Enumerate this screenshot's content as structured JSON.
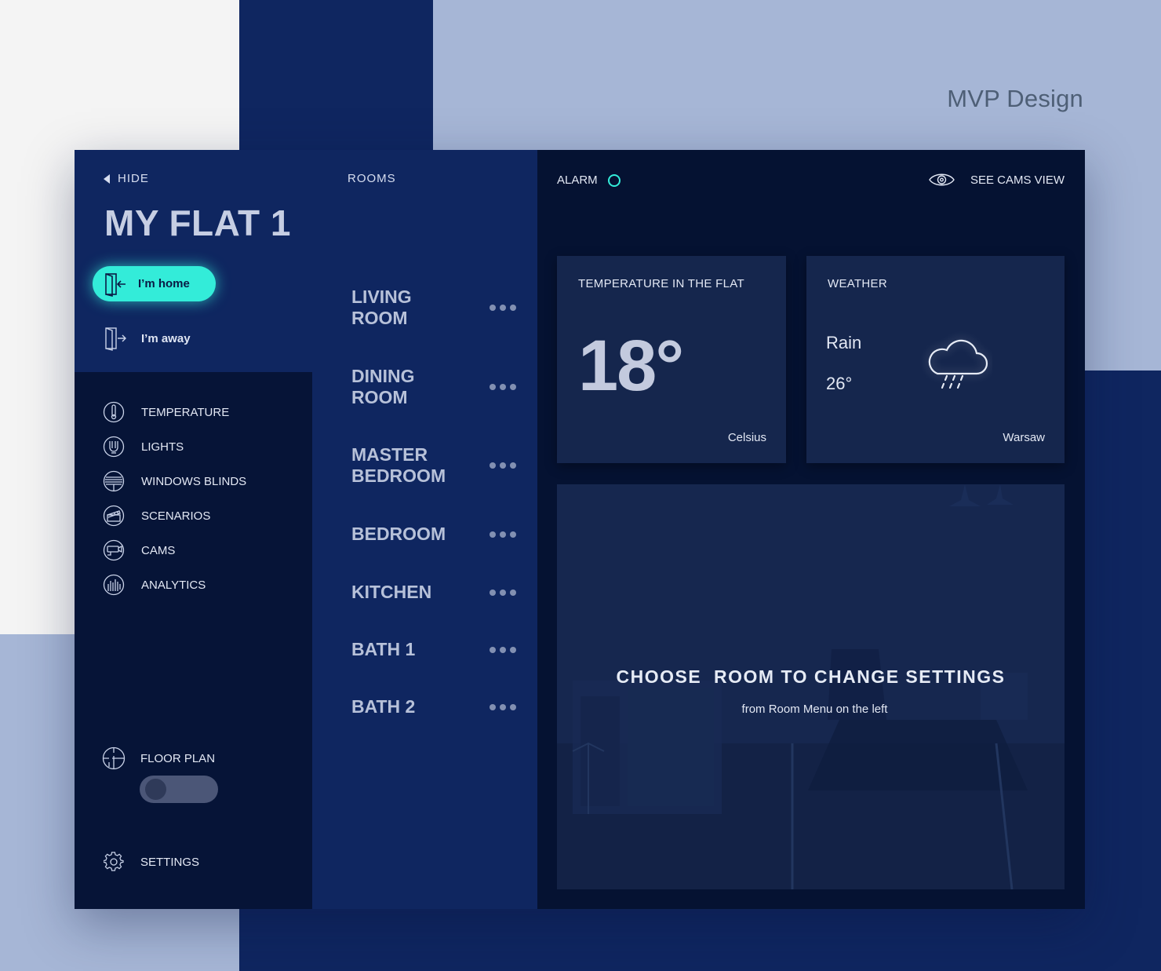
{
  "brand": {
    "title": "MVP Design"
  },
  "sidebar": {
    "hide_label": "HIDE",
    "flat_name": "MY FLAT 1",
    "modes": {
      "home": "I’m home",
      "away": "I’m away"
    },
    "menu": [
      {
        "label": "TEMPERATURE",
        "icon": "thermometer-icon"
      },
      {
        "label": "LIGHTS",
        "icon": "bulb-icon"
      },
      {
        "label": "WINDOWS BLINDS",
        "icon": "blinds-icon"
      },
      {
        "label": "SCENARIOS",
        "icon": "clapperboard-icon"
      },
      {
        "label": "CAMS",
        "icon": "camera-icon"
      },
      {
        "label": "ANALYTICS",
        "icon": "analytics-icon"
      }
    ],
    "floor_plan_label": "FLOOR PLAN",
    "floor_plan_enabled": false,
    "settings_label": "SETTINGS"
  },
  "rooms": {
    "header": "ROOMS",
    "items": [
      "LIVING ROOM",
      "DINING ROOM",
      "MASTER BEDROOM",
      "BEDROOM",
      "KITCHEN",
      "BATH 1",
      "BATH 2"
    ]
  },
  "main": {
    "alarm_label": "ALARM",
    "cams_view_label": "SEE CAMS VIEW",
    "temperature": {
      "title": "TEMPERATURE IN THE FLAT",
      "value": "18°",
      "unit": "Celsius"
    },
    "weather": {
      "title": "WEATHER",
      "condition": "Rain",
      "temp": "26°",
      "city": "Warsaw"
    },
    "room_prompt": {
      "heading": "CHOOSE  ROOM TO CHANGE SETTINGS",
      "sub": "from Room Menu on the left"
    }
  },
  "colors": {
    "accent": "#33ecd9",
    "navy": "#0f2660",
    "dark": "#061437",
    "light_bg": "#a6b6d6"
  }
}
